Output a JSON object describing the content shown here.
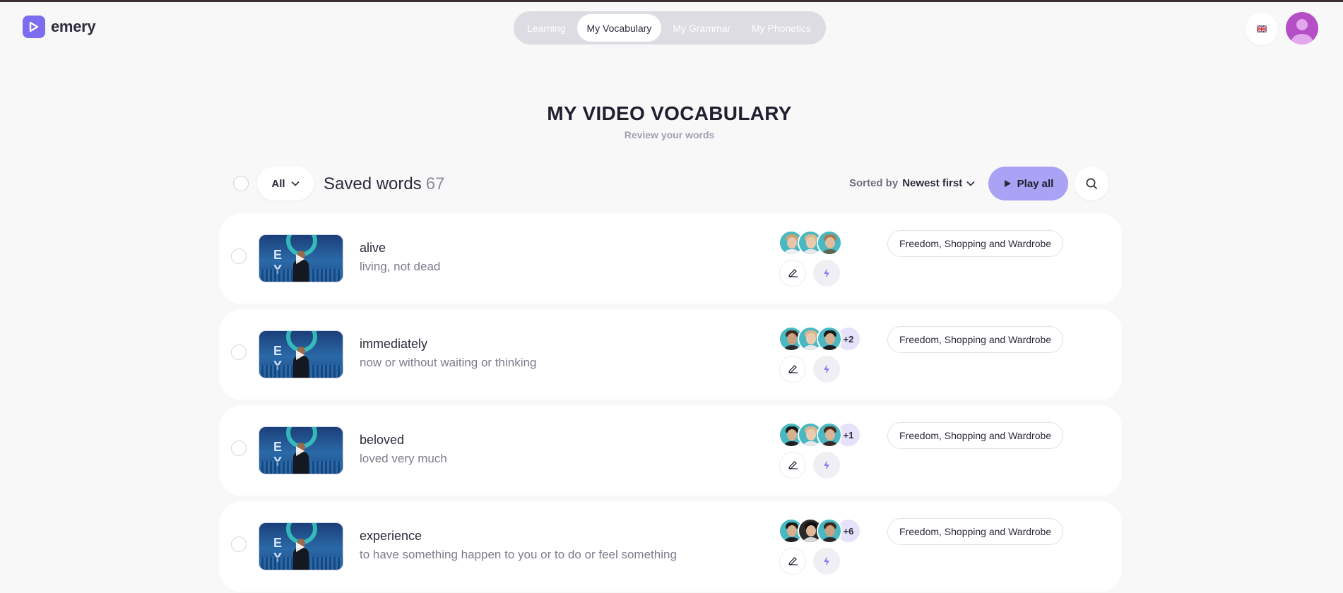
{
  "app": {
    "name": "emery",
    "logo_icon": "play-icon",
    "accent": "#7c6cf0"
  },
  "nav": {
    "tabs": [
      {
        "label": "Learning",
        "active": false
      },
      {
        "label": "My Vocabulary",
        "active": true
      },
      {
        "label": "My Grammar",
        "active": false
      },
      {
        "label": "My Phonetics",
        "active": false
      }
    ]
  },
  "header": {
    "language_icon": "uk-flag-icon",
    "profile_icon": "user-avatar-icon"
  },
  "page": {
    "title": "MY VIDEO VOCABULARY",
    "subtitle": "Review your words"
  },
  "toolbar": {
    "filter_label": "All",
    "saved_label": "Saved words",
    "saved_count": "67",
    "sort_label": "Sorted by",
    "sort_value": "Newest first",
    "play_all_label": "Play all",
    "play_all_color": "#a9a2f5"
  },
  "words": [
    {
      "word": "alive",
      "definition": "living, not dead",
      "extra_avatars": "",
      "topic": "Freedom, Shopping and Wardrobe"
    },
    {
      "word": "immediately",
      "definition": "now or without waiting or thinking",
      "extra_avatars": "+2",
      "topic": "Freedom, Shopping and Wardrobe"
    },
    {
      "word": "beloved",
      "definition": "loved very much",
      "extra_avatars": "+1",
      "topic": "Freedom, Shopping and Wardrobe"
    },
    {
      "word": "experience",
      "definition": "to have something happen to you or to do or feel something",
      "extra_avatars": "+6",
      "topic": "Freedom, Shopping and Wardrobe"
    }
  ]
}
